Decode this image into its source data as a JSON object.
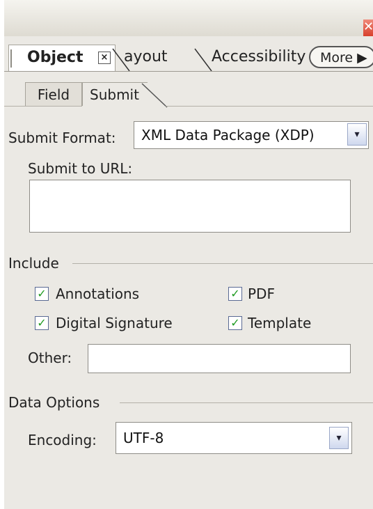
{
  "window": {
    "close_glyph": "✕"
  },
  "tabs": {
    "object_label": "Object",
    "object_close_glyph": "×",
    "layout_label": "ayout",
    "accessibility_label": "Accessibility",
    "more_label": "More ▶"
  },
  "subtabs": {
    "field_label": "Field",
    "submit_label": "Submit"
  },
  "submit": {
    "format_label": "Submit Format:",
    "format_value": "XML Data Package (XDP)",
    "url_label": "Submit to URL:",
    "url_value": ""
  },
  "include": {
    "section_label": "Include",
    "annotations_label": "Annotations",
    "annotations_checked": true,
    "pdf_label": "PDF",
    "pdf_checked": true,
    "digsig_label": "Digital Signature",
    "digsig_checked": true,
    "template_label": "Template",
    "template_checked": true,
    "other_label": "Other:",
    "other_value": ""
  },
  "data_options": {
    "section_label": "Data Options",
    "encoding_label": "Encoding:",
    "encoding_value": "UTF-8"
  },
  "icons": {
    "checkmark": "✓",
    "dropdown_arrow": "▾"
  },
  "colors": {
    "panel_bg": "#ebe9e4",
    "check_green": "#1f9b21",
    "close_red": "#d8402c"
  }
}
